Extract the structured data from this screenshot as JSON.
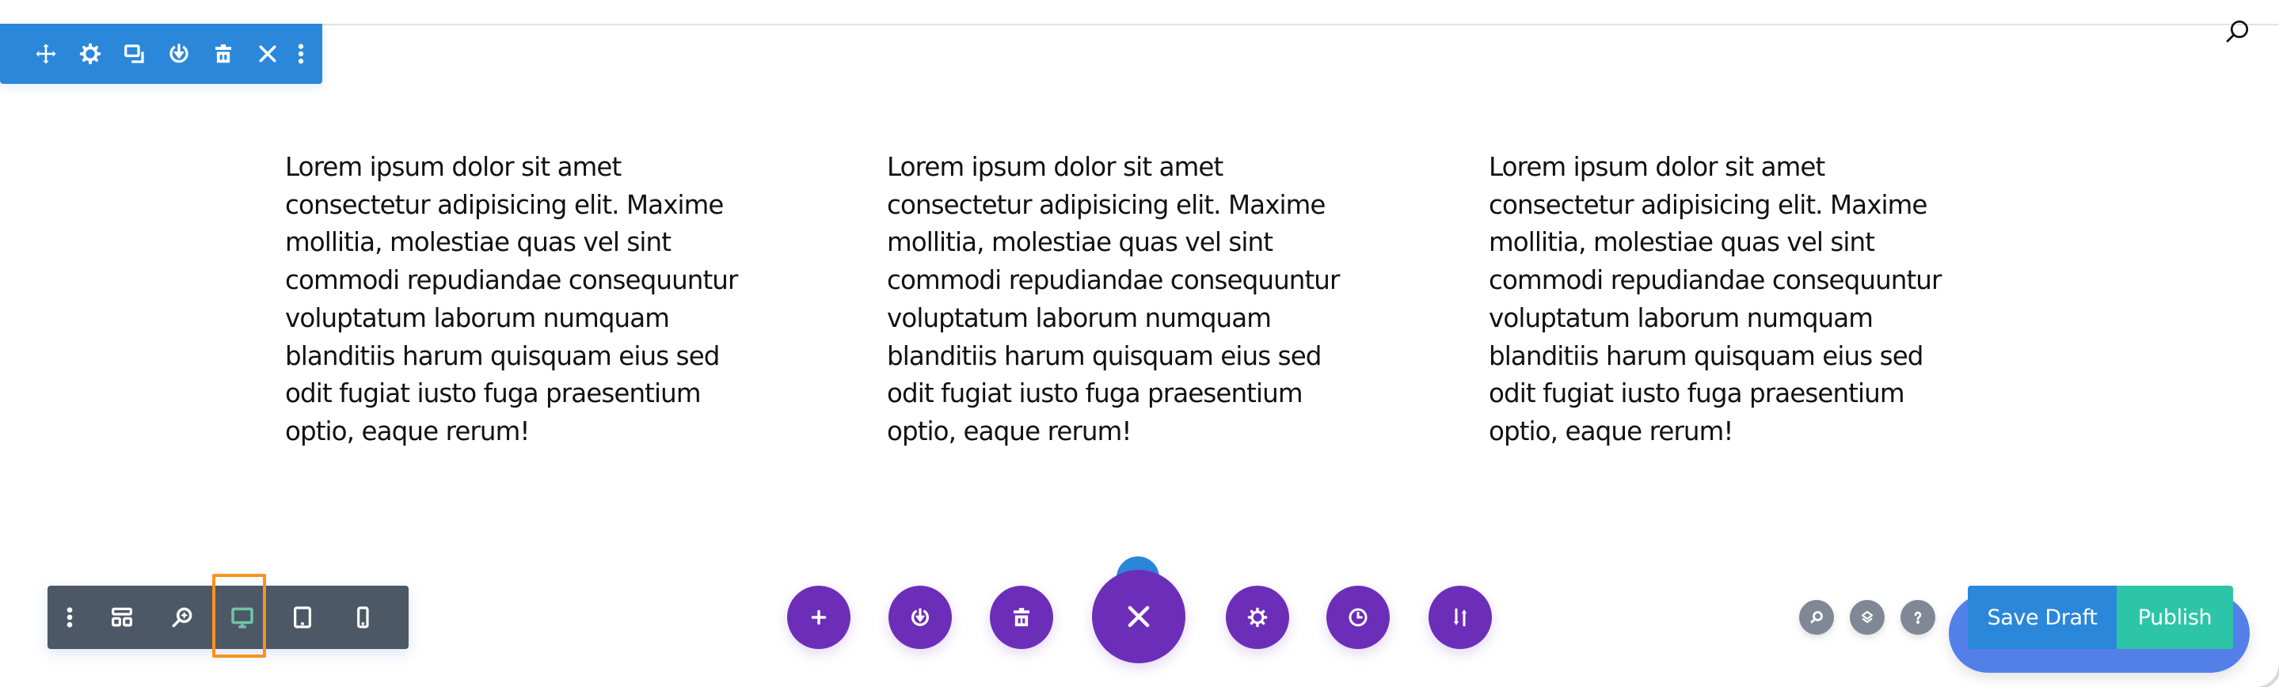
{
  "section_toolbar": {
    "color": "#2b87da",
    "buttons": [
      {
        "icon": "move-icon",
        "label": "Move"
      },
      {
        "icon": "gear-icon",
        "label": "Settings"
      },
      {
        "icon": "duplicate-icon",
        "label": "Duplicate"
      },
      {
        "icon": "save-to-library-icon",
        "label": "Save to Library"
      },
      {
        "icon": "trash-icon",
        "label": "Delete"
      },
      {
        "icon": "close-icon",
        "label": "Close"
      },
      {
        "icon": "more-vertical-icon",
        "label": "More"
      }
    ]
  },
  "top_search": {
    "icon": "search-icon"
  },
  "columns": [
    {
      "lines": [
        "Lorem ipsum dolor sit amet",
        "consectetur adipisicing elit. Maxime",
        "mollitia, molestiae quas vel sint",
        "commodi repudiandae consequuntur",
        "voluptatum laborum numquam",
        "blanditiis harum quisquam eius sed",
        "odit fugiat iusto fuga praesentium",
        "optio, eaque rerum!"
      ]
    },
    {
      "lines": [
        "Lorem ipsum dolor sit amet",
        "consectetur adipisicing elit. Maxime",
        "mollitia, molestiae quas vel sint",
        "commodi repudiandae consequuntur",
        "voluptatum laborum numquam",
        "blanditiis harum quisquam eius sed",
        "odit fugiat iusto fuga praesentium",
        "optio, eaque rerum!"
      ]
    },
    {
      "lines": [
        "Lorem ipsum dolor sit amet",
        "consectetur adipisicing elit. Maxime",
        "mollitia, molestiae quas vel sint",
        "commodi repudiandae consequuntur",
        "voluptatum laborum numquam",
        "blanditiis harum quisquam eius sed",
        "odit fugiat iusto fuga praesentium",
        "optio, eaque rerum!"
      ]
    }
  ],
  "view_toolbar": {
    "color": "#4c5866",
    "active_view": "desktop",
    "active_color": "#6fc4a6",
    "highlight_color": "#f7931e",
    "buttons": [
      {
        "icon": "more-vertical-icon",
        "label": "Menu"
      },
      {
        "icon": "wireframe-view-icon",
        "label": "Wireframe View"
      },
      {
        "icon": "zoom-icon",
        "label": "Zoom"
      },
      {
        "icon": "desktop-icon",
        "label": "Desktop View"
      },
      {
        "icon": "tablet-icon",
        "label": "Tablet View"
      },
      {
        "icon": "phone-icon",
        "label": "Phone View"
      }
    ]
  },
  "page_actions": {
    "color": "#6c2eb9",
    "buttons": [
      {
        "icon": "plus-icon",
        "label": "Add"
      },
      {
        "icon": "save-to-library-icon",
        "label": "Save to Library"
      },
      {
        "icon": "trash-icon",
        "label": "Clear Layout"
      },
      {
        "icon": "close-icon",
        "label": "Close"
      },
      {
        "icon": "gear-icon",
        "label": "Page Settings"
      },
      {
        "icon": "history-icon",
        "label": "History"
      },
      {
        "icon": "portability-icon",
        "label": "Import/Export"
      }
    ]
  },
  "right_tools": [
    {
      "icon": "search-icon",
      "label": "Search"
    },
    {
      "icon": "layers-icon",
      "label": "Layers"
    },
    {
      "icon": "help-icon",
      "label": "Help"
    }
  ],
  "save_draft": {
    "label": "Save Draft",
    "color": "#2b87da"
  },
  "publish": {
    "label": "Publish",
    "color": "#2cc5a8"
  }
}
